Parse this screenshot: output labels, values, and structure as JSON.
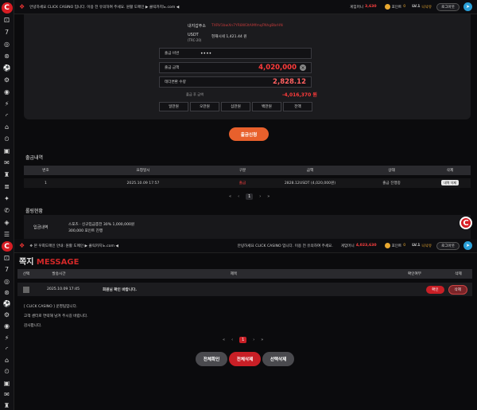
{
  "top": {
    "notice": "안녕하세요 CLICK CASINO 입니다. 이용 전 유의하여 주세요. 원활 도메인 ▶ 클릭카지노.com ◀",
    "balance_label": "게임머니",
    "balance": "3,630",
    "point_label": "포인트",
    "point": "0",
    "level": "LV.1",
    "nickname": "니낙유",
    "logout": "로그아웃"
  },
  "top2": {
    "marquee": "❖ 본 우회도메인 안내: 원활 도메인 ▶ 클릭카지노.com ◀",
    "notice": "안녕하세요 CLICK CASINO 입니다. 이용 전 유의하여 주세요.",
    "balance_label": "게임머니",
    "balance": "4,023,630",
    "point_label": "포인트",
    "point": "0",
    "level": "LV.1",
    "nickname": "니낙유",
    "logout": "로그아웃"
  },
  "withdraw": {
    "wallet_label": "내지갑주소",
    "wallet_value": "TXRV1bwXn7YR8W3tAMfmqFNhgBbrHN",
    "usdt_label": "USDT",
    "usdt_sub": "(TRC-20)",
    "usdt_rate": "현재시세 1,421.44 원",
    "password_label": "출금 비번",
    "password_value": "••••",
    "amount_label": "출금 금액",
    "amount_value": "4,020,000",
    "tether_label": "테더변환 수량",
    "tether_value": "2,828.12",
    "after_label": "출금 후 금액",
    "after_value": "-4,016,370 원",
    "quick": [
      "일만원",
      "오만원",
      "십만원",
      "백만원",
      "전액"
    ],
    "submit": "출금신청"
  },
  "history": {
    "title": "출금내역",
    "columns": [
      "번호",
      "요청일시",
      "구분",
      "금액",
      "상태",
      "삭제"
    ],
    "rows": [
      [
        "1",
        "2025.10.09 17:57",
        "출금",
        "2828.12USDT (4,020,000원)",
        "출금 진행중",
        "내역 삭제"
      ]
    ],
    "pager": [
      "«",
      "‹",
      "1",
      "›",
      "»"
    ]
  },
  "status": {
    "title": "롤링현황",
    "deposit_label": "입금내역",
    "line1": "스포츠 · 신규입금충전 30% 1,000,000원",
    "line2": "300,000 포인트 진행"
  },
  "message": {
    "title_ko": "쪽지",
    "title_en": "MESSAGE",
    "columns": [
      "선택",
      "발송시간",
      "제목",
      "확인여부",
      "삭제"
    ],
    "row": {
      "time": "2025.10.09 17:45",
      "subject": "회원님 확인 바랍니다.",
      "confirm": "확인",
      "delete": "삭제"
    },
    "body": [
      "[ CLICK CASINO ] 운영팀입니다.",
      "고객 센터로 연락해 남겨 주시길 바랍니다.",
      "감사합니다."
    ],
    "pager": [
      "«",
      "‹",
      "1",
      "›",
      "»"
    ],
    "btn_confirm_all": "전체확인",
    "btn_delete_all": "전체삭제",
    "btn_delete_sel": "선택삭제"
  }
}
